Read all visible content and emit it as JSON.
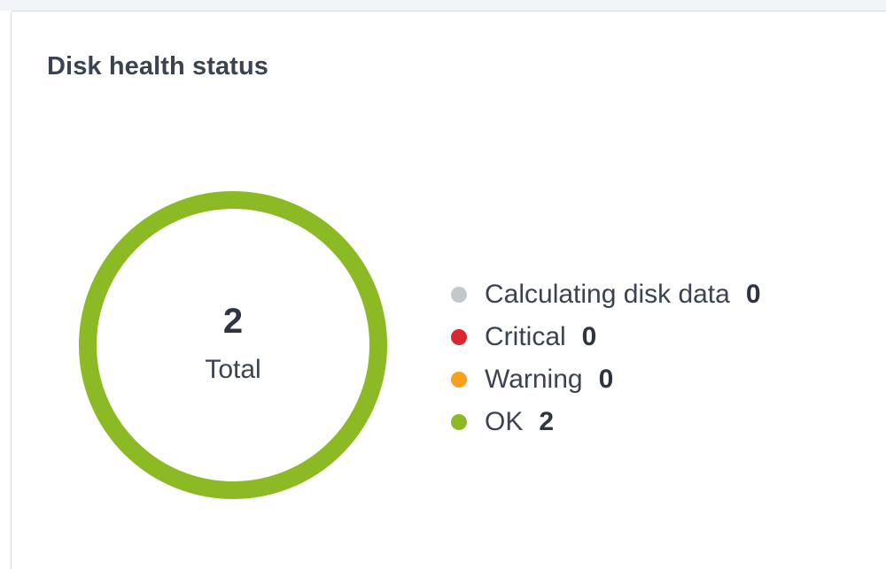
{
  "card": {
    "title": "Disk health status"
  },
  "summary": {
    "total": "2",
    "total_caption": "Total"
  },
  "colors": {
    "calculating": "#c4c8cd",
    "critical": "#d9262f",
    "warning": "#f7a01b",
    "ok": "#8cba24"
  },
  "legend": [
    {
      "label": "Calculating disk data",
      "value": "0",
      "count": 0,
      "color": "#c4c8cd"
    },
    {
      "label": "Critical",
      "value": "0",
      "count": 0,
      "color": "#d9262f"
    },
    {
      "label": "Warning",
      "value": "0",
      "count": 0,
      "color": "#f7a01b"
    },
    {
      "label": "OK",
      "value": "2",
      "count": 2,
      "color": "#8cba24"
    }
  ]
}
